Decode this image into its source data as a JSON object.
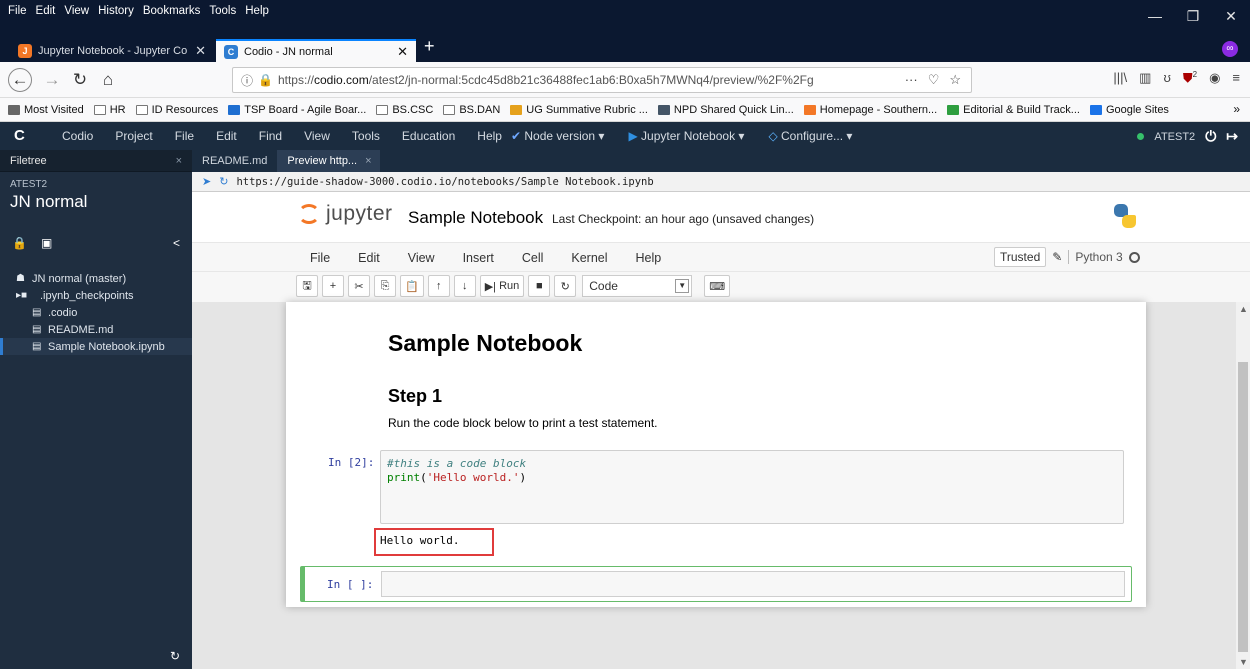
{
  "browser": {
    "menu": [
      "File",
      "Edit",
      "View",
      "History",
      "Bookmarks",
      "Tools",
      "Help"
    ],
    "tabs": [
      {
        "title": "Jupyter Notebook - Jupyter Co",
        "active": false
      },
      {
        "title": "Codio - JN normal",
        "active": true
      }
    ],
    "url_prefix": "https://",
    "url_domain": "codio.com",
    "url_rest": "/atest2/jn-normal:5cdc45d8b21c36488fec1ab6:B0xa5h7MWNq4/preview/%2F%2Fg",
    "bookmarks": [
      "Most Visited",
      "HR",
      "ID Resources",
      "TSP Board - Agile Boar...",
      "BS.CSC",
      "BS.DAN",
      "UG Summative Rubric ...",
      "NPD Shared Quick Lin...",
      "Homepage - Southern...",
      "Editorial & Build Track...",
      "Google Sites"
    ],
    "ext_badge": "2"
  },
  "codio": {
    "menu": [
      "Codio",
      "Project",
      "File",
      "Edit",
      "Find",
      "View",
      "Tools",
      "Education",
      "Help"
    ],
    "dropdowns": [
      "Node version ▾",
      "Jupyter Notebook ▾",
      "Configure... ▾"
    ],
    "user": "ATEST2"
  },
  "sidebar": {
    "tab": "Filetree",
    "project_label": "ATEST2",
    "project_name": "JN normal",
    "tree": [
      {
        "label": "JN normal (master)",
        "type": "root"
      },
      {
        "label": ".ipynb_checkpoints",
        "type": "folder"
      },
      {
        "label": ".codio",
        "type": "file"
      },
      {
        "label": "README.md",
        "type": "file"
      },
      {
        "label": "Sample Notebook.ipynb",
        "type": "file",
        "selected": true
      }
    ]
  },
  "editor": {
    "tabs": [
      "README.md",
      "Preview http..."
    ],
    "preview_url": "https://guide-shadow-3000.codio.io/notebooks/Sample Notebook.ipynb"
  },
  "jupyter": {
    "logo_text": "jupyter",
    "notebook_title": "Sample Notebook",
    "checkpoint": "Last Checkpoint: an hour ago  (unsaved changes)",
    "menu": [
      "File",
      "Edit",
      "View",
      "Insert",
      "Cell",
      "Kernel",
      "Help"
    ],
    "trusted": "Trusted",
    "kernel": "Python 3",
    "run_label": "Run",
    "cell_type": "Code"
  },
  "notebook": {
    "h1": "Sample Notebook",
    "h2": "Step 1",
    "paragraph": "Run the code block below to print a test statement.",
    "cell1_prompt": "In [2]:",
    "code_comment": "#this is a code block",
    "code_func": "print",
    "code_string": "'Hello world.'",
    "output": "Hello world.",
    "cell2_prompt": "In [ ]:"
  }
}
